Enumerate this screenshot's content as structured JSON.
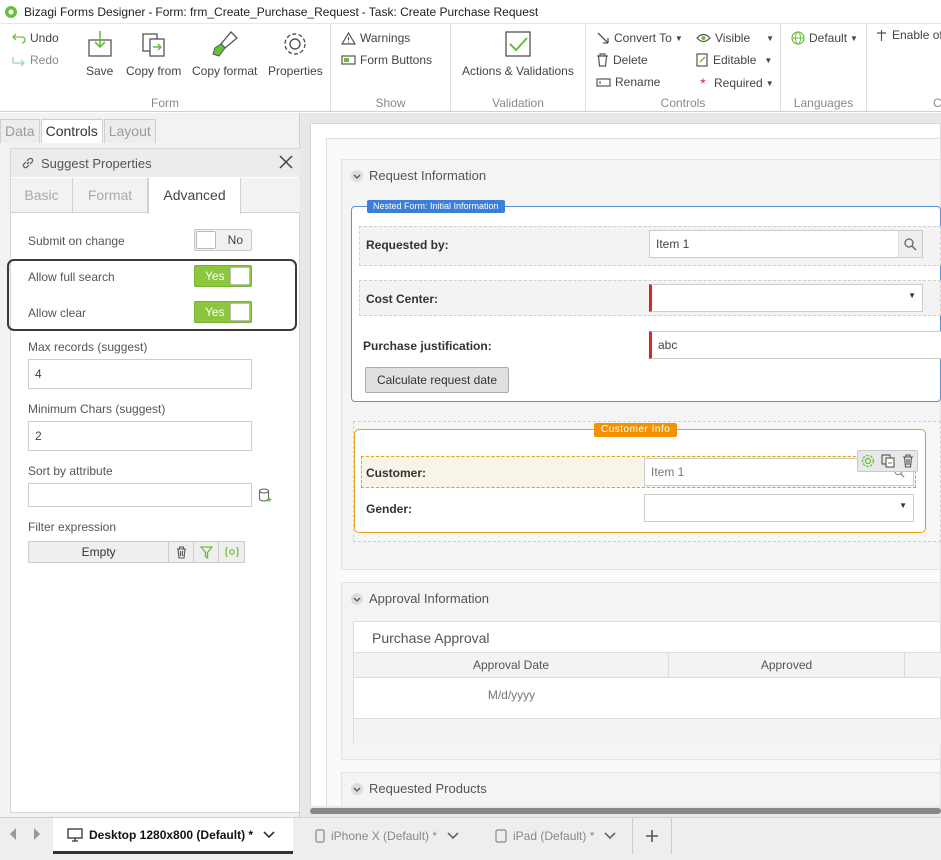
{
  "titlebar": {
    "app": "Bizagi Forms Designer",
    "sep": "-",
    "form": "Form: frm_Create_Purchase_Request",
    "task": "Task:  Create Purchase Request"
  },
  "ribbon": {
    "undo": "Undo",
    "redo": "Redo",
    "save": "Save",
    "copy_from": "Copy from",
    "copy_format": "Copy format",
    "properties": "Properties",
    "group_form": "Form",
    "warnings": "Warnings",
    "form_buttons": "Form Buttons",
    "group_show": "Show",
    "actions": "Actions & Validations",
    "group_validation": "Validation",
    "convert_to": "Convert To",
    "delete": "Delete",
    "rename": "Rename",
    "visible": "Visible",
    "editable": "Editable",
    "required": "Required",
    "group_controls": "Controls",
    "default": "Default",
    "group_languages": "Languages",
    "enable": "Enable of",
    "group_cut": "C"
  },
  "left": {
    "tabs": [
      "Data",
      "Controls",
      "Layout"
    ],
    "panel_title": "Suggest Properties",
    "ptabs": [
      "Basic",
      "Format",
      "Advanced"
    ],
    "submit_on_change": "Submit on change",
    "submit_toggle": "No",
    "allow_full_search": "Allow full search",
    "allow_full_search_toggle": "Yes",
    "allow_clear": "Allow clear",
    "allow_clear_toggle": "Yes",
    "max_records_label": "Max records (suggest)",
    "max_records_value": "4",
    "min_chars_label": "Minimum Chars (suggest)",
    "min_chars_value": "2",
    "sort_label": "Sort by attribute",
    "sort_value": "",
    "filter_label": "Filter expression",
    "filter_value": "Empty"
  },
  "form": {
    "request_info": "Request Information",
    "nested_title": "Nested Form: Initial Information",
    "requested_by_label": "Requested by:",
    "requested_by_value": "Item 1",
    "cost_center_label": "Cost Center:",
    "cost_center_value": "",
    "justification_label": "Purchase justification:",
    "justification_value": "abc",
    "calc_button": "Calculate request date",
    "customer_info": "Customer Info",
    "customer_label": "Customer:",
    "customer_value": "Item 1",
    "gender_label": "Gender:",
    "gender_value": "",
    "approval_info": "Approval Information",
    "grid_title": "Purchase Approval",
    "grid_cols": [
      "Approval Date",
      "Approved"
    ],
    "grid_date_placeholder": "M/d/yyyy",
    "requested_products": "Requested Products"
  },
  "devices": {
    "desktop": "Desktop 1280x800 (Default)",
    "desktop_mark": "*",
    "iphone": "iPhone X (Default)",
    "iphone_mark": "*",
    "ipad": "iPad (Default)",
    "ipad_mark": "*"
  },
  "colors": {
    "accent_green": "#8cc63e",
    "nested_blue": "#3b7fd8",
    "customer_orange": "#f39200",
    "required_red": "#d62828"
  }
}
